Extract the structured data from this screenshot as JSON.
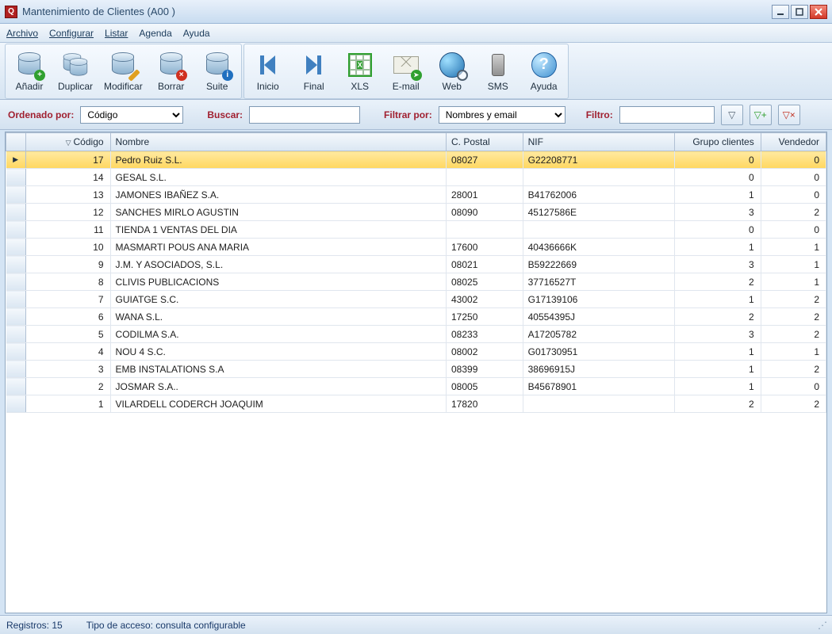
{
  "window": {
    "title": "Mantenimiento de Clientes (A00 )"
  },
  "menu": {
    "archivo": "Archivo",
    "configurar": "Configurar",
    "listar": "Listar",
    "agenda": "Agenda",
    "ayuda": "Ayuda"
  },
  "toolbar": {
    "anadir": "Añadir",
    "duplicar": "Duplicar",
    "modificar": "Modificar",
    "borrar": "Borrar",
    "suite": "Suite",
    "inicio": "Inicio",
    "final": "Final",
    "xls": "XLS",
    "email": "E-mail",
    "web": "Web",
    "sms": "SMS",
    "ayuda": "Ayuda"
  },
  "filter": {
    "ordenado_label": "Ordenado por:",
    "ordenado_value": "Código",
    "buscar_label": "Buscar:",
    "buscar_value": "",
    "filtrarpor_label": "Filtrar por:",
    "filtrarpor_value": "Nombres y email",
    "filtro_label": "Filtro:",
    "filtro_value": ""
  },
  "columns": {
    "codigo": "Código",
    "nombre": "Nombre",
    "cpostal": "C. Postal",
    "nif": "NIF",
    "grupo": "Grupo clientes",
    "vendedor": "Vendedor"
  },
  "rows": [
    {
      "codigo": "17",
      "nombre": "Pedro Ruiz S.L.",
      "cp": "08027",
      "nif": "G22208771",
      "grupo": "0",
      "vend": "0",
      "sel": true
    },
    {
      "codigo": "14",
      "nombre": "GESAL S.L.",
      "cp": "",
      "nif": "",
      "grupo": "0",
      "vend": "0"
    },
    {
      "codigo": "13",
      "nombre": "JAMONES IBAÑEZ S.A.",
      "cp": "28001",
      "nif": "B41762006",
      "grupo": "1",
      "vend": "0"
    },
    {
      "codigo": "12",
      "nombre": "SANCHES MIRLO  AGUSTIN",
      "cp": "08090",
      "nif": "45127586E",
      "grupo": "3",
      "vend": "2"
    },
    {
      "codigo": "11",
      "nombre": "TIENDA 1 VENTAS DEL DIA",
      "cp": "",
      "nif": "",
      "grupo": "0",
      "vend": "0"
    },
    {
      "codigo": "10",
      "nombre": "MASMARTI POUS  ANA MARIA",
      "cp": "17600",
      "nif": "40436666K",
      "grupo": "1",
      "vend": "1"
    },
    {
      "codigo": "9",
      "nombre": "J.M. Y ASOCIADOS, S.L.",
      "cp": "08021",
      "nif": "B59222669",
      "grupo": "3",
      "vend": "1"
    },
    {
      "codigo": "8",
      "nombre": "CLIVIS PUBLICACIONS",
      "cp": "08025",
      "nif": "37716527T",
      "grupo": "2",
      "vend": "1"
    },
    {
      "codigo": "7",
      "nombre": "GUIATGE S.C.",
      "cp": "43002",
      "nif": "G17139106",
      "grupo": "1",
      "vend": "2"
    },
    {
      "codigo": "6",
      "nombre": "WANA S.L.",
      "cp": "17250",
      "nif": "40554395J",
      "grupo": "2",
      "vend": "2"
    },
    {
      "codigo": "5",
      "nombre": "CODILMA S.A.",
      "cp": "08233",
      "nif": "A17205782",
      "grupo": "3",
      "vend": "2"
    },
    {
      "codigo": "4",
      "nombre": "NOU 4 S.C.",
      "cp": "08002",
      "nif": "G01730951",
      "grupo": "1",
      "vend": "1"
    },
    {
      "codigo": "3",
      "nombre": "EMB INSTALATIONS S.A",
      "cp": "08399",
      "nif": "38696915J",
      "grupo": "1",
      "vend": "2"
    },
    {
      "codigo": "2",
      "nombre": "JOSMAR S.A..",
      "cp": "08005",
      "nif": "B45678901",
      "grupo": "1",
      "vend": "0"
    },
    {
      "codigo": "1",
      "nombre": "VILARDELL CODERCH  JOAQUIM",
      "cp": "17820",
      "nif": "",
      "grupo": "2",
      "vend": "2"
    }
  ],
  "status": {
    "registros": "Registros:  15",
    "acceso": "Tipo de acceso: consulta configurable"
  }
}
